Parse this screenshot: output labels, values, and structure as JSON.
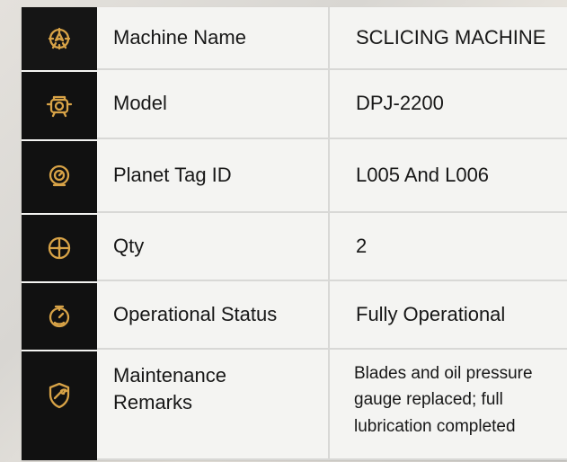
{
  "table": {
    "rows": [
      {
        "icon": "gear-rocket-icon",
        "label": "Machine Name",
        "value": "SCLICING MACHINE"
      },
      {
        "icon": "engine-icon",
        "label": "Model",
        "value": "DPJ-2200"
      },
      {
        "icon": "tag-gauge-icon",
        "label": "Planet Tag ID",
        "value": "L005 And L006"
      },
      {
        "icon": "crosshair-gauge-icon",
        "label": "Qty",
        "value": "2"
      },
      {
        "icon": "timer-gauge-icon",
        "label": "Operational Status",
        "value": "Fully Operational"
      },
      {
        "icon": "shield-wrench-icon",
        "label_lines": [
          "Maintenance",
          "Remarks"
        ],
        "value_lines": [
          "Blades and oil pressure",
          "gauge replaced; full",
          "lubrication completed"
        ]
      }
    ]
  }
}
